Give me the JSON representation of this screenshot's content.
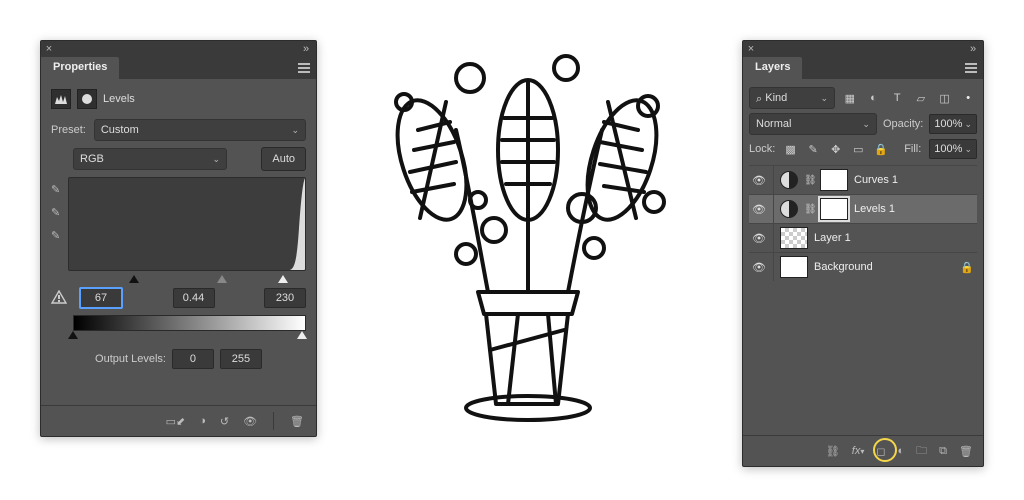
{
  "properties": {
    "panel_title": "Properties",
    "adjustment_name": "Levels",
    "preset_label": "Preset:",
    "preset_value": "Custom",
    "channel_value": "RGB",
    "auto_label": "Auto",
    "input_black": "67",
    "input_gamma": "0.44",
    "input_white": "230",
    "output_label": "Output Levels:",
    "output_black": "0",
    "output_white": "255"
  },
  "layers": {
    "panel_title": "Layers",
    "filter_label": "Kind",
    "blend_mode": "Normal",
    "opacity_label": "Opacity:",
    "opacity_value": "100%",
    "lock_label": "Lock:",
    "fill_label": "Fill:",
    "fill_value": "100%",
    "items": [
      {
        "name": "Curves 1",
        "type": "adjustment",
        "selected": false,
        "locked": false
      },
      {
        "name": "Levels 1",
        "type": "adjustment",
        "selected": true,
        "locked": false
      },
      {
        "name": "Layer 1",
        "type": "pixel",
        "selected": false,
        "locked": false
      },
      {
        "name": "Background",
        "type": "background",
        "selected": false,
        "locked": true
      }
    ]
  }
}
